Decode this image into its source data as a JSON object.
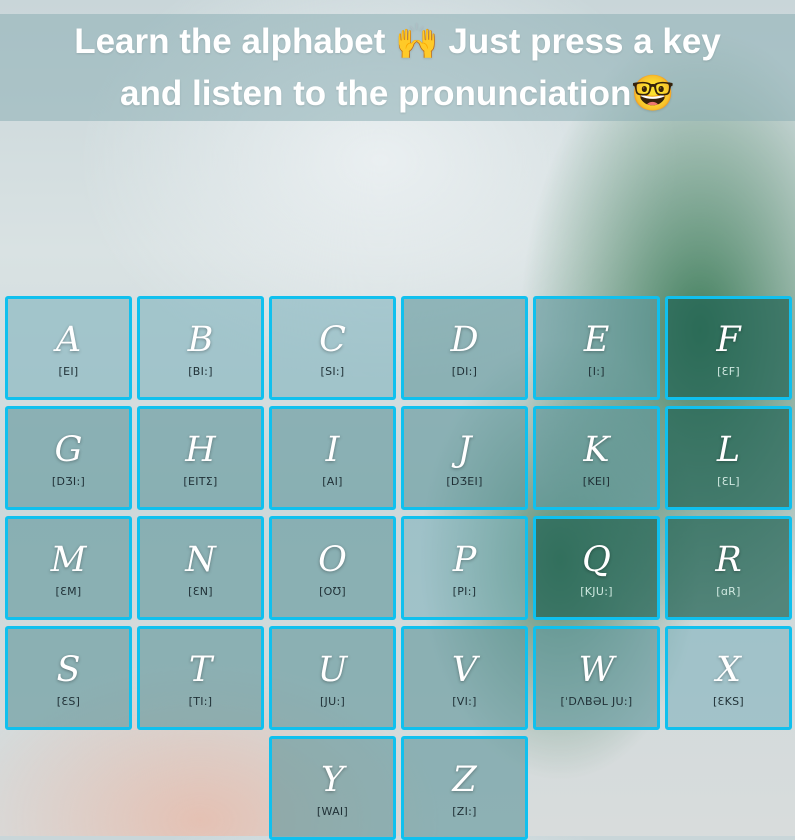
{
  "header": {
    "line1": "Learn the alphabet 🙌 Just press a key",
    "line2": "and listen to the pronunciation🤓"
  },
  "keys": [
    {
      "letter": "A",
      "ipa": "[EI]"
    },
    {
      "letter": "B",
      "ipa": "[BI:]"
    },
    {
      "letter": "C",
      "ipa": "[SI:]"
    },
    {
      "letter": "D",
      "ipa": "[DI:]"
    },
    {
      "letter": "E",
      "ipa": "[I:]"
    },
    {
      "letter": "F",
      "ipa": "[ƐF]"
    },
    {
      "letter": "G",
      "ipa": "[DƷI:]"
    },
    {
      "letter": "H",
      "ipa": "[EITΣ]"
    },
    {
      "letter": "I",
      "ipa": "[AI]"
    },
    {
      "letter": "J",
      "ipa": "[DƷEI]"
    },
    {
      "letter": "K",
      "ipa": "[KEI]"
    },
    {
      "letter": "L",
      "ipa": "[ƐL]"
    },
    {
      "letter": "M",
      "ipa": "[ƐM]"
    },
    {
      "letter": "N",
      "ipa": "[ƐN]"
    },
    {
      "letter": "O",
      "ipa": "[OƱ]"
    },
    {
      "letter": "P",
      "ipa": "[PI:]"
    },
    {
      "letter": "Q",
      "ipa": "[KJU:]"
    },
    {
      "letter": "R",
      "ipa": "[ɑR]"
    },
    {
      "letter": "S",
      "ipa": "[ƐS]"
    },
    {
      "letter": "T",
      "ipa": "[TI:]"
    },
    {
      "letter": "U",
      "ipa": "[JU:]"
    },
    {
      "letter": "V",
      "ipa": "[VI:]"
    },
    {
      "letter": "W",
      "ipa": "[ˈDɅBƏL JU:]"
    },
    {
      "letter": "X",
      "ipa": "[ƐKS]"
    },
    {
      "letter": "Y",
      "ipa": "[WAI]"
    },
    {
      "letter": "Z",
      "ipa": "[ZI:]"
    }
  ]
}
